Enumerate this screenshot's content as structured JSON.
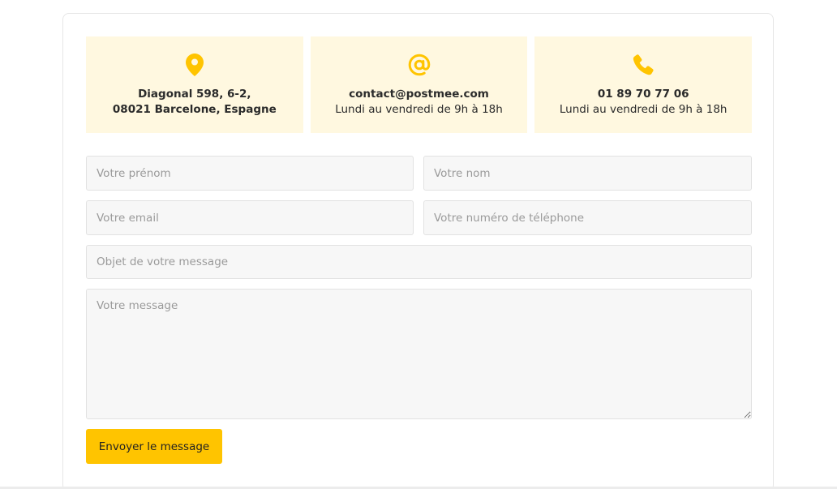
{
  "contact_info": {
    "address": {
      "icon": "location-pin-icon",
      "line1": "Diagonal 598, 6-2,",
      "line2": "08021 Barcelone, Espagne"
    },
    "email": {
      "icon": "at-sign-icon",
      "line1": "contact@postmee.com",
      "line2": "Lundi au vendredi de 9h à 18h"
    },
    "phone": {
      "icon": "phone-icon",
      "line1": "01 89 70 77 06",
      "line2": "Lundi au vendredi de 9h à 18h"
    }
  },
  "form": {
    "first_name_placeholder": "Votre prénom",
    "last_name_placeholder": "Votre nom",
    "email_placeholder": "Votre email",
    "phone_placeholder": "Votre numéro de téléphone",
    "subject_placeholder": "Objet de votre message",
    "message_placeholder": "Votre message",
    "submit_label": "Envoyer le message"
  },
  "colors": {
    "accent": "#ffc400",
    "info_background": "#fff8e0",
    "field_background": "#f7f7f7"
  }
}
